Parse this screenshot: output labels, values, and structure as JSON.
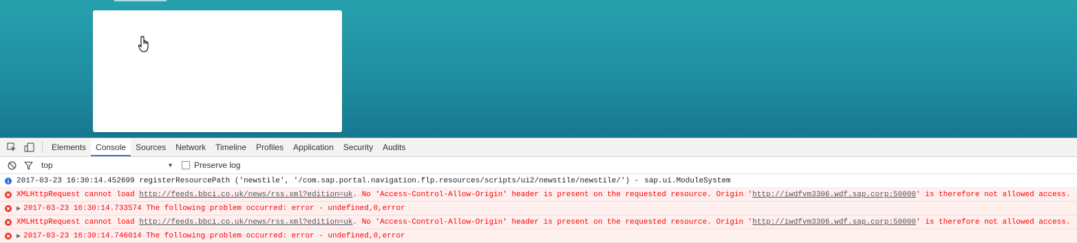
{
  "devtools": {
    "tabs": [
      "Elements",
      "Console",
      "Sources",
      "Network",
      "Timeline",
      "Profiles",
      "Application",
      "Security",
      "Audits"
    ],
    "active_tab": "Console",
    "context": "top",
    "preserve_log_label": "Preserve log"
  },
  "console": {
    "info": {
      "text": "2017-03-23 16:30:14.452699 registerResourcePath ('newstile', '/com.sap.portal.navigation.flp.resources/scripts/ui2/newstile/newstile/') -",
      "source": "sap.ui.ModuleSystem"
    },
    "xhr_error": {
      "prefix": "XMLHttpRequest cannot load ",
      "url": "http://feeds.bbci.co.uk/news/rss.xml?edition=uk",
      "middle": ". No 'Access-Control-Allow-Origin' header is present on the requested resource. Origin '",
      "origin": "http://iwdfvm3306.wdf.sap.corp:50000",
      "suffix": "' is therefore not allowed access."
    },
    "problem1": "2017-03-23 16:30:14.733574 The following problem occurred: error - undefined,0,error",
    "problem2": "2017-03-23 16:30:14.746014 The following problem occurred: error - undefined,0,error"
  },
  "colors": {
    "error": "#ff0000",
    "error_bg": "#fff0f0",
    "info_icon": "#2e6bd6",
    "active_tab_underline": "#3879d9"
  }
}
